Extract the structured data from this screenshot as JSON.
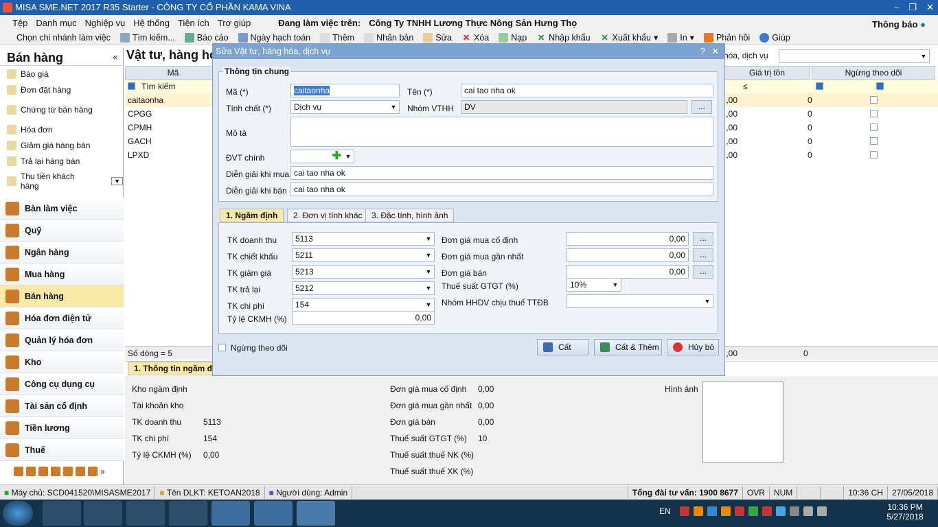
{
  "window": {
    "title": "MISA SME.NET 2017 R35 Starter - CÔNG TY CỔ PHẦN KAMA VINA"
  },
  "menu": {
    "items": [
      "Tệp",
      "Danh mục",
      "Nghiệp vụ",
      "Hệ thống",
      "Tiện ích",
      "Trợ giúp"
    ],
    "working_label": "Đang làm việc trên:",
    "company": "Công Ty TNHH Lương Thực Nông Sản Hưng Thọ",
    "notification": "Thông báo"
  },
  "toolbar": {
    "branch": "Chọn chi nhánh làm việc",
    "search": "Tìm kiếm...",
    "report": "Báo cáo",
    "posting_date": "Ngày hạch toán",
    "add": "Thêm",
    "duplicate": "Nhân bản",
    "edit": "Sửa",
    "delete": "Xóa",
    "reload": "Nạp",
    "import": "Nhập khẩu",
    "export": "Xuất khẩu",
    "print": "In",
    "feedback": "Phản hồi",
    "help": "Giúp"
  },
  "sidebar": {
    "title": "Bán hàng",
    "items": [
      "Báo giá",
      "Đơn đặt hàng",
      "Chứng từ bán hàng",
      "Hóa đơn",
      "Giảm giá hàng bán",
      "Trả lại hàng bán",
      "Thu tiền khách hàng"
    ],
    "modules": [
      "Bàn làm việc",
      "Quỹ",
      "Ngân hàng",
      "Mua hàng",
      "Bán hàng",
      "Hóa đơn điện tử",
      "Quản lý hóa đơn",
      "Kho",
      "Công cụ dụng cụ",
      "Tài sản cố định",
      "Tiền lương",
      "Thuế"
    ]
  },
  "grid": {
    "title": "Vật tư, hàng hóa",
    "filter_label": "hóa, dịch vụ",
    "col_code": "Mã",
    "col_stock_value": "Giá trị tồn",
    "col_inactive": "Ngừng theo dõi",
    "search_label": "Tìm kiếm",
    "le_symbol": "≤",
    "rows": [
      {
        "code": "caitaonha",
        "val": ",00",
        "stock": "0"
      },
      {
        "code": "CPGG",
        "val": ",00",
        "stock": "0"
      },
      {
        "code": "CPMH",
        "val": ",00",
        "stock": "0"
      },
      {
        "code": "GACH",
        "val": ",00",
        "stock": "0"
      },
      {
        "code": "LPXD",
        "val": ",00",
        "stock": "0"
      }
    ],
    "row_count": "Số dòng = 5",
    "footer_val": ",00",
    "footer_stock": "0"
  },
  "detail": {
    "tab": "1. Thông tin ngầm định",
    "left": [
      [
        "Kho ngầm định",
        ""
      ],
      [
        "Tài khoản kho",
        ""
      ],
      [
        "TK doanh thu",
        "5113"
      ],
      [
        "TK chi phí",
        "154"
      ],
      [
        "Tỷ lệ CKMH (%)",
        "0,00"
      ]
    ],
    "mid": [
      [
        "Đơn giá mua cố định",
        "0,00"
      ],
      [
        "Đơn giá mua gần nhất",
        "0,00"
      ],
      [
        "Đơn giá bán",
        "0,00"
      ],
      [
        "Thuế suất GTGT (%)",
        "10"
      ],
      [
        "Thuế suất thuế NK (%)",
        ""
      ],
      [
        "Thuế suất thuế XK (%)",
        ""
      ]
    ],
    "image_label": "Hình ảnh"
  },
  "dialog": {
    "title": "Sửa Vật tư, hàng hóa, dịch vụ",
    "group_title": "Thông tin chung",
    "code_label": "Mã (*)",
    "code": "caitaonha",
    "name_label": "Tên (*)",
    "name": "cai tao nha ok",
    "type_label": "Tính chất (*)",
    "type": "Dịch vụ",
    "group_label": "Nhóm VTHH",
    "group": "DV",
    "desc_label": "Mô tả",
    "unit_label": "ĐVT chính",
    "buy_desc_label": "Diễn giải khi mua",
    "buy_desc": "cai tao nha ok",
    "sell_desc_label": "Diễn giải khi bán",
    "sell_desc": "cai tao nha ok",
    "tabs": [
      "1. Ngầm định",
      "2. Đơn vị tính khác",
      "3. Đặc tính, hình ảnh"
    ],
    "left_fields": [
      {
        "label": "TK doanh thu",
        "value": "5113"
      },
      {
        "label": "TK chiết khấu",
        "value": "5211"
      },
      {
        "label": "TK giảm giá",
        "value": "5213"
      },
      {
        "label": "TK trả lại",
        "value": "5212"
      },
      {
        "label": "TK chi phí",
        "value": "154"
      }
    ],
    "discount_label": "Tỷ lệ CKMH (%)",
    "discount": "0,00",
    "right_fields": [
      {
        "label": "Đơn giá mua cố định",
        "value": "0,00"
      },
      {
        "label": "Đơn giá mua gần nhất",
        "value": "0,00"
      },
      {
        "label": "Đơn giá bán",
        "value": "0,00"
      }
    ],
    "vat_label": "Thuế suất GTGT (%)",
    "vat": "10%",
    "ttdb_label": "Nhóm HHDV chịu thuế TTĐB",
    "inactive_label": "Ngừng theo dõi",
    "save": "Cất",
    "save_add": "Cất & Thêm",
    "cancel": "Hủy bỏ"
  },
  "status": {
    "server": "Máy chủ: SCD041520\\MISASME2017",
    "db": "Tên DLKT: KETOAN2018",
    "user": "Người dùng: Admin",
    "hotline": "Tổng đài tư vấn: 1900 8677",
    "ovr": "OVR",
    "num": "NUM",
    "time": "10:36 CH",
    "date": "27/05/2018"
  },
  "taskbar": {
    "lang": "EN",
    "time": "10:36 PM",
    "date": "5/27/2018"
  }
}
